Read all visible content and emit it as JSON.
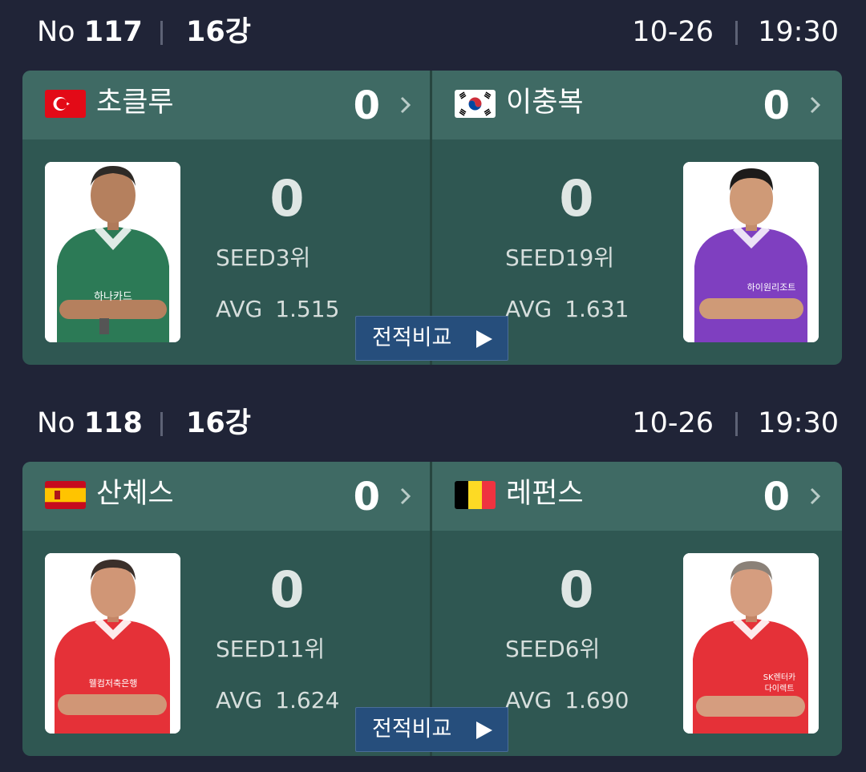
{
  "matches": [
    {
      "no_label": "No",
      "no_number": "117",
      "round": "16강",
      "date": "10-26",
      "time": "19:30",
      "compare_label": "전적비교",
      "left": {
        "country": "turkey-flag",
        "name": "초클루",
        "set_score": "0",
        "big_score": "0",
        "seed": "SEED3위",
        "avg_label": "AVG",
        "avg_value": "1.515",
        "shirt_color": "#2c7a56",
        "sponsor": "하나카드"
      },
      "right": {
        "country": "korea-flag",
        "name": "이충복",
        "set_score": "0",
        "big_score": "0",
        "seed": "SEED19위",
        "avg_label": "AVG",
        "avg_value": "1.631",
        "shirt_color": "#7f3fc0",
        "sponsor": "하이원리조트"
      }
    },
    {
      "no_label": "No",
      "no_number": "118",
      "round": "16강",
      "date": "10-26",
      "time": "19:30",
      "compare_label": "전적비교",
      "left": {
        "country": "spain-flag",
        "name": "산체스",
        "set_score": "0",
        "big_score": "0",
        "seed": "SEED11위",
        "avg_label": "AVG",
        "avg_value": "1.624",
        "shirt_color": "#e53138",
        "sponsor": "웰컴저축은행"
      },
      "right": {
        "country": "belgium-flag",
        "name": "레펀스",
        "set_score": "0",
        "big_score": "0",
        "seed": "SEED6위",
        "avg_label": "AVG",
        "avg_value": "1.690",
        "shirt_color": "#e53138",
        "sponsor": "SK렌터카 다이렉트"
      }
    }
  ]
}
